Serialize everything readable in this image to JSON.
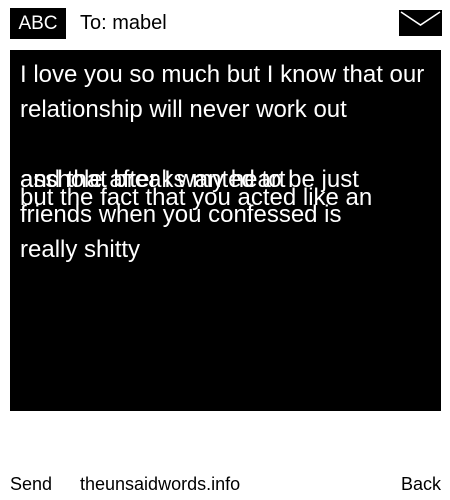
{
  "header": {
    "input_mode": "ABC",
    "to_label": "To: mabel",
    "message_icon": "envelope-icon"
  },
  "message": {
    "text_first": "I love you so much but I know that our relationship will never work out\n\nand that breaks my heart",
    "text_second": "asshole after I wanted to be just friends when you confessed is",
    "text_third": "but the fact that you acted like an",
    "text_fourth": "really shitty"
  },
  "footer": {
    "send_label": "Send",
    "site_label": "theunsaidwords.info",
    "back_label": "Back"
  },
  "colors": {
    "background": "#ffffff",
    "message_bg": "#000000",
    "message_text": "#ffffff"
  }
}
